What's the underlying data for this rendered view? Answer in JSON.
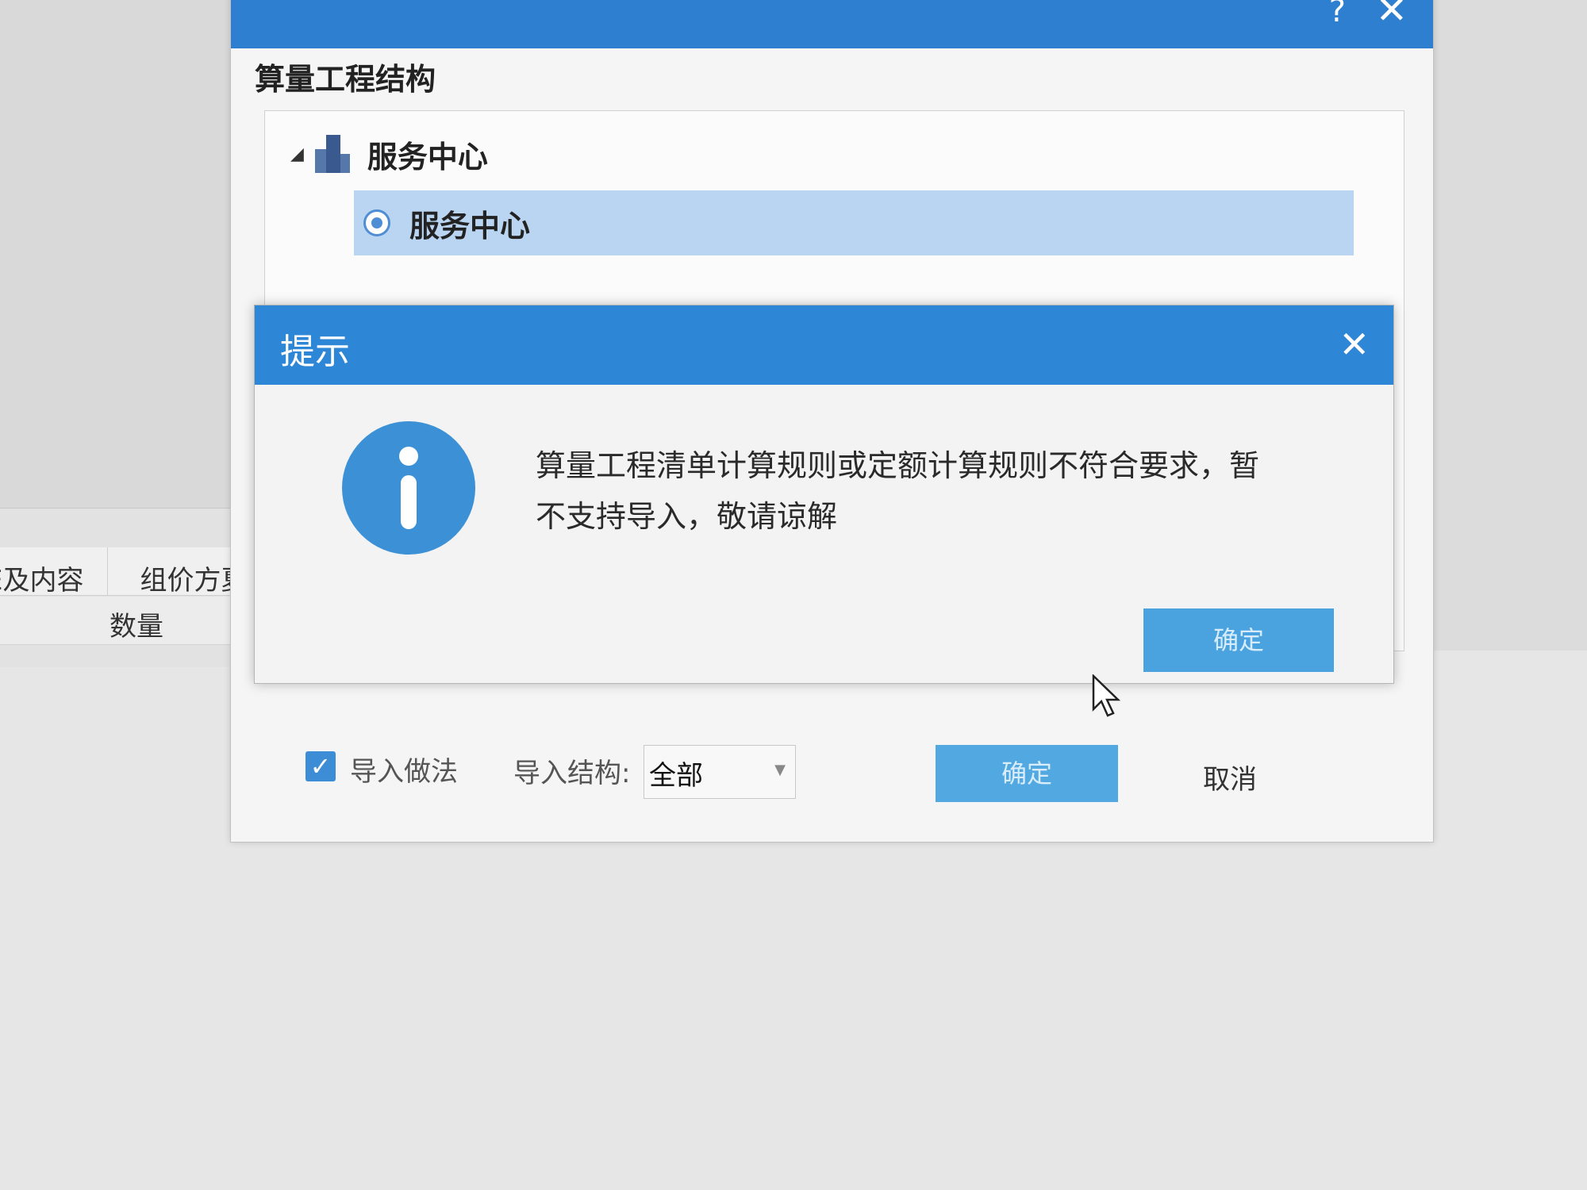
{
  "outer_dialog": {
    "title": "",
    "help_icon": "help-icon",
    "close_icon": "close-icon",
    "section_title": "算量工程结构",
    "tree": {
      "root_label": "服务中心",
      "root_icon": "building-icon",
      "child_label": "服务中心",
      "child_icon": "radio-icon"
    },
    "footer": {
      "checkbox_label": "导入做法",
      "checkbox_checked": true,
      "structure_label": "导入结构:",
      "structure_value": "全部",
      "ok_label": "确定",
      "cancel_label": "取消"
    }
  },
  "background": {
    "tabs": [
      "E及内容",
      "组价方夏"
    ],
    "column_header": "数量"
  },
  "alert": {
    "title": "提示",
    "close_icon": "close-icon",
    "info_icon": "info-icon",
    "message": "算量工程清单计算规则或定额计算规则不符合要求，暂不支持导入，敬请谅解",
    "ok_label": "确定"
  },
  "colors": {
    "titlebar_blue": "#2e86d6",
    "button_blue": "#4aa3df",
    "selection_blue": "#b9d5f2"
  }
}
